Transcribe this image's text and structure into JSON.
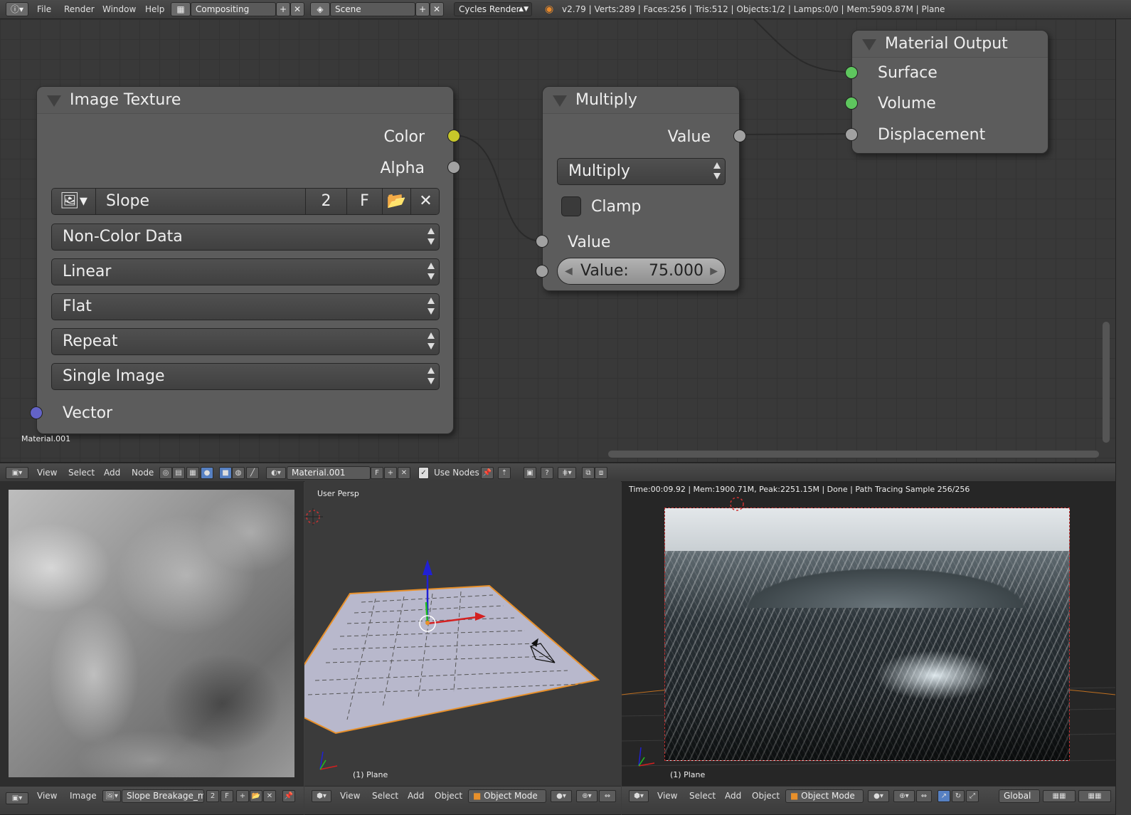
{
  "topbar": {
    "menus": [
      "File",
      "Render",
      "Window",
      "Help"
    ],
    "layout": "Compositing",
    "scene": "Scene",
    "engine": "Cycles Render",
    "stats": "v2.79 | Verts:289 | Faces:256 | Tris:512 | Objects:1/2 | Lamps:0/0 | Mem:5909.87M | Plane"
  },
  "nodes": {
    "image_texture": {
      "title": "Image Texture",
      "out_color": "Color",
      "out_alpha": "Alpha",
      "image_name": "Slope Break...heightt.png",
      "users": "2",
      "fake": "F",
      "color_space": "Non-Color Data",
      "interpolation": "Linear",
      "projection": "Flat",
      "extension": "Repeat",
      "source": "Single Image",
      "in_vector": "Vector"
    },
    "multiply": {
      "title": "Multiply",
      "out_value": "Value",
      "operation": "Multiply",
      "clamp": "Clamp",
      "in_value": "Value",
      "value_label": "Value:",
      "value": "75.000"
    },
    "material_output": {
      "title": "Material Output",
      "surface": "Surface",
      "volume": "Volume",
      "displacement": "Displacement"
    },
    "material_label": "Material.001"
  },
  "node_header": {
    "menus": [
      "View",
      "Select",
      "Add",
      "Node"
    ],
    "material": "Material.001",
    "fake": "F",
    "use_nodes": "Use Nodes"
  },
  "image_editor": {
    "menus": [
      "View",
      "Image"
    ],
    "image": "Slope Breakage_mp...",
    "users": "2",
    "fake": "F"
  },
  "view3d": {
    "label": "User Persp",
    "object": "(1) Plane",
    "menus": [
      "View",
      "Select",
      "Add",
      "Object"
    ],
    "mode": "Object Mode"
  },
  "render_view": {
    "stats": "Time:00:09.92 | Mem:1900.71M, Peak:2251.15M | Done | Path Tracing Sample 256/256",
    "object": "(1) Plane",
    "menus": [
      "View",
      "Select",
      "Add",
      "Object"
    ],
    "mode": "Object Mode",
    "orientation": "Global"
  },
  "colors": {
    "socket_color": "#c7c72a",
    "socket_shader": "#5ec65e",
    "socket_vector": "#6363c7",
    "socket_value": "#a1a1a1",
    "active_button": "#5680c2"
  }
}
